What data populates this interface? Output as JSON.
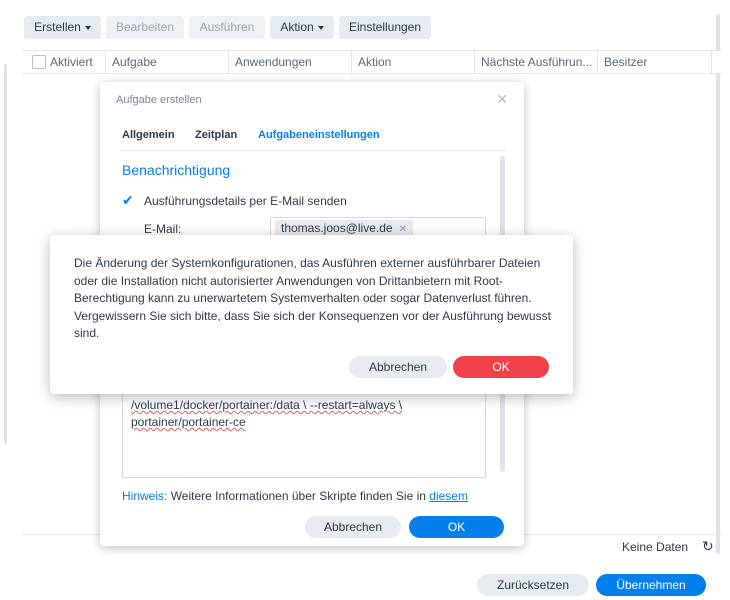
{
  "toolbar": {
    "create_label": "Erstellen",
    "edit_label": "Bearbeiten",
    "run_label": "Ausführen",
    "action_label": "Aktion",
    "settings_label": "Einstellungen"
  },
  "table": {
    "columns": [
      "Aktiviert",
      "Aufgabe",
      "Anwendungen",
      "Aktion",
      "Nächste Ausführun...",
      "Besitzer"
    ],
    "empty_label": "Keine Daten",
    "refresh_icon": "↻"
  },
  "footer": {
    "reset_label": "Zurücksetzen",
    "apply_label": "Übernehmen"
  },
  "task_dialog": {
    "title": "Aufgabe erstellen",
    "close_icon": "✕",
    "tabs": [
      "Allgemein",
      "Zeitplan",
      "Aufgabeneinstellungen"
    ],
    "active_tab": "Aufgabeneinstellungen",
    "section_title": "Benachrichtigung",
    "check_icon": "✔",
    "email_checkbox_label": "Ausführungsdetails per E-Mail senden",
    "email_label": "E-Mail:",
    "email_value": "thomas.joos@live.de",
    "chip_remove_icon": "✕",
    "script_line1": "/volume1/docker/portainer:/data \\ --restart=always \\",
    "script_line2": "portainer/portainer-ce",
    "hint_label": "Hinweis:",
    "hint_text": " Weitere Informationen über Skripte finden Sie in ",
    "hint_link": "diesem",
    "cancel_label": "Abbrechen",
    "ok_label": "OK"
  },
  "alert": {
    "message": "Die Änderung der Systemkonfigurationen, das Ausführen externer ausführbarer Dateien oder die Installation nicht autorisierter Anwendungen von Drittanbietern mit Root-Berechtigung kann zu unerwartetem Systemverhalten oder sogar Datenverlust führen. Vergewissern Sie sich bitte, dass Sie sich der Konsequenzen vor der Ausführung bewusst sind.",
    "cancel_label": "Abbrechen",
    "ok_label": "OK"
  },
  "colors": {
    "accent": "#057feb",
    "danger": "#f0404a",
    "button_grey": "#e6ebf0"
  }
}
